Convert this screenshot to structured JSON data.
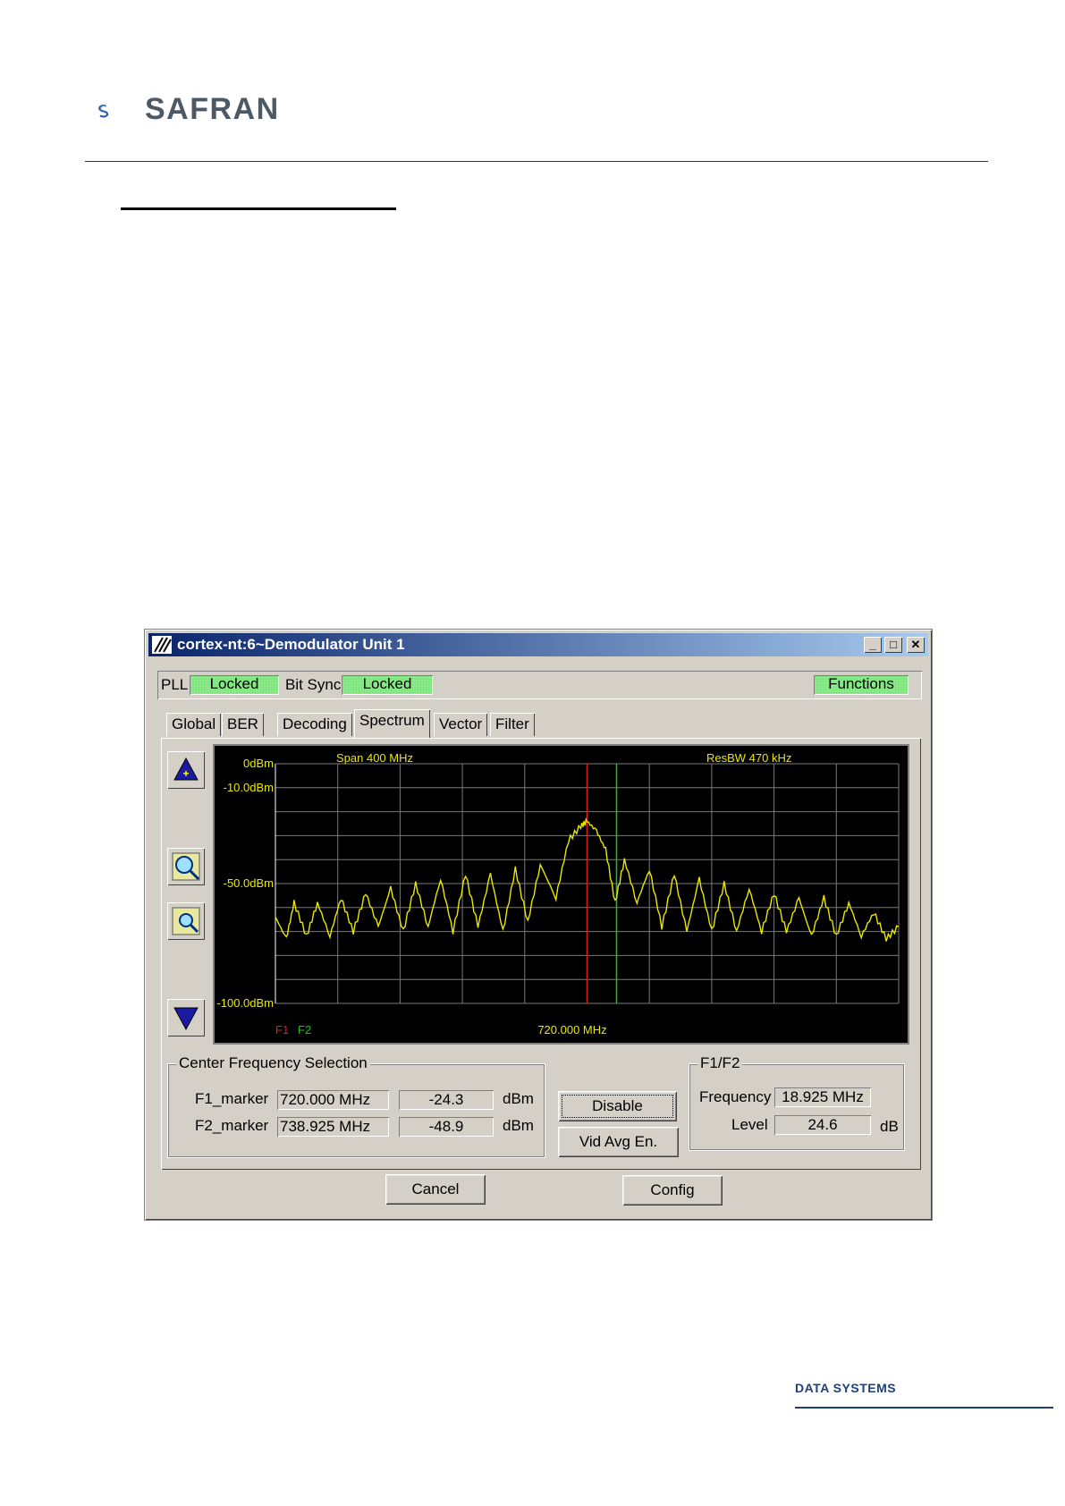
{
  "document": {
    "logo_text": "SAFRAN",
    "footer_text": "DATA SYSTEMS"
  },
  "window": {
    "title": "cortex-nt:6~Demodulator Unit 1",
    "minimize_icon": "minimize-icon",
    "maximize_icon": "maximize-icon",
    "close_icon": "close-icon"
  },
  "status": {
    "pll_label": "PLL",
    "pll_value": "Locked",
    "bitsync_label": "Bit Sync",
    "bitsync_value": "Locked",
    "functions_label": "Functions",
    "status_color": "#88ee88"
  },
  "tabs": [
    "Global",
    "BER",
    "Decoding",
    "Spectrum",
    "Vector",
    "Filter"
  ],
  "active_tab": "Spectrum",
  "spectrum": {
    "span_label": "Span 400 MHz",
    "resbw_label": "ResBW 470 kHz",
    "center_label": "720.000 MHz",
    "f1_label": "F1",
    "f2_label": "F2",
    "y_ticks": [
      "0dBm",
      "-10.0dBm",
      "-50.0dBm",
      "-100.0dBm"
    ],
    "side_buttons": [
      "up-arrow-icon",
      "zoom-in-icon",
      "zoom-out-icon",
      "down-arrow-icon"
    ],
    "trace_color": "#e8e800",
    "f1_color": "#d62020",
    "f2_color": "#20c020"
  },
  "chart_data": {
    "type": "line",
    "title": "",
    "xlabel": "720.000 MHz",
    "ylabel": "",
    "span_mhz": 400,
    "center_mhz": 720,
    "xlim": [
      520,
      920
    ],
    "ylim": [
      -100,
      0
    ],
    "y_tick_values": [
      0,
      -10,
      -50,
      -100
    ],
    "markers": [
      {
        "name": "F1",
        "x": 720.0,
        "y": -24.3
      },
      {
        "name": "F2",
        "x": 738.925,
        "y": -48.9
      }
    ],
    "series": [
      {
        "values": [
          [
            520,
            -64
          ],
          [
            527,
            -73
          ],
          [
            532,
            -58
          ],
          [
            540,
            -72
          ],
          [
            547,
            -58
          ],
          [
            555,
            -72
          ],
          [
            562,
            -56
          ],
          [
            570,
            -70
          ],
          [
            578,
            -54
          ],
          [
            586,
            -68
          ],
          [
            594,
            -52
          ],
          [
            602,
            -70
          ],
          [
            610,
            -50
          ],
          [
            618,
            -68
          ],
          [
            626,
            -48
          ],
          [
            634,
            -70
          ],
          [
            642,
            -46
          ],
          [
            650,
            -68
          ],
          [
            658,
            -46
          ],
          [
            666,
            -70
          ],
          [
            674,
            -44
          ],
          [
            682,
            -66
          ],
          [
            690,
            -42
          ],
          [
            700,
            -56
          ],
          [
            708,
            -32
          ],
          [
            716,
            -26
          ],
          [
            720,
            -24
          ],
          [
            726,
            -28
          ],
          [
            732,
            -36
          ],
          [
            738,
            -58
          ],
          [
            744,
            -40
          ],
          [
            752,
            -58
          ],
          [
            760,
            -44
          ],
          [
            768,
            -68
          ],
          [
            776,
            -46
          ],
          [
            784,
            -70
          ],
          [
            792,
            -48
          ],
          [
            800,
            -70
          ],
          [
            808,
            -50
          ],
          [
            816,
            -70
          ],
          [
            824,
            -52
          ],
          [
            832,
            -70
          ],
          [
            840,
            -54
          ],
          [
            848,
            -70
          ],
          [
            856,
            -56
          ],
          [
            864,
            -72
          ],
          [
            872,
            -56
          ],
          [
            880,
            -72
          ],
          [
            888,
            -58
          ],
          [
            896,
            -72
          ],
          [
            904,
            -62
          ],
          [
            912,
            -73
          ],
          [
            920,
            -68
          ]
        ]
      }
    ]
  },
  "center_freq": {
    "title": "Center Frequency Selection",
    "f1_label": "F1_marker",
    "f1_freq": "720.000 MHz",
    "f1_level": "-24.3",
    "f1_unit": "dBm",
    "f2_label": "F2_marker",
    "f2_freq": "738.925 MHz",
    "f2_level": "-48.9",
    "f2_unit": "dBm"
  },
  "mid_buttons": {
    "disable": "Disable",
    "vid_avg": "Vid Avg En."
  },
  "f1f2": {
    "title": "F1/F2",
    "frequency_label": "Frequency",
    "frequency_value": "18.925 MHz",
    "level_label": "Level",
    "level_value": "24.6",
    "level_unit": "dB"
  },
  "bottom": {
    "cancel": "Cancel",
    "config": "Config"
  }
}
